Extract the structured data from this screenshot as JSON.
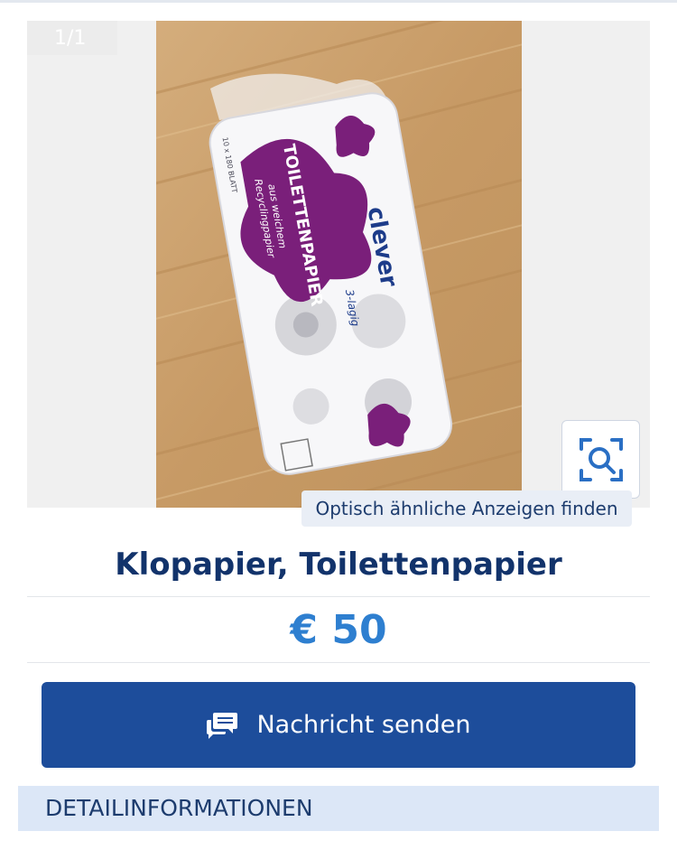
{
  "gallery": {
    "counter": "1/1",
    "visual_search_label": "Optisch ähnliche Anzeigen finden",
    "zoom_icon": "image-search-icon"
  },
  "product_pack": {
    "brand": "clever",
    "product": "TOILETTENPAPIER",
    "line1": "aus weichem",
    "line2": "Recyclingpapier",
    "ply": "3-lagig",
    "count": "10 x 180 BLATT"
  },
  "listing": {
    "title": "Klopapier, Toilettenpapier",
    "price": "€ 50"
  },
  "actions": {
    "message_label": "Nachricht senden",
    "message_icon": "chat-bubbles-icon"
  },
  "sections": {
    "details_header": "DETAILINFORMATIONEN"
  },
  "colors": {
    "title": "#12336b",
    "price": "#2e7fd0",
    "button": "#1d4d9b",
    "package_purple": "#7a1f7a",
    "floor_wood": "#c9a06d"
  }
}
